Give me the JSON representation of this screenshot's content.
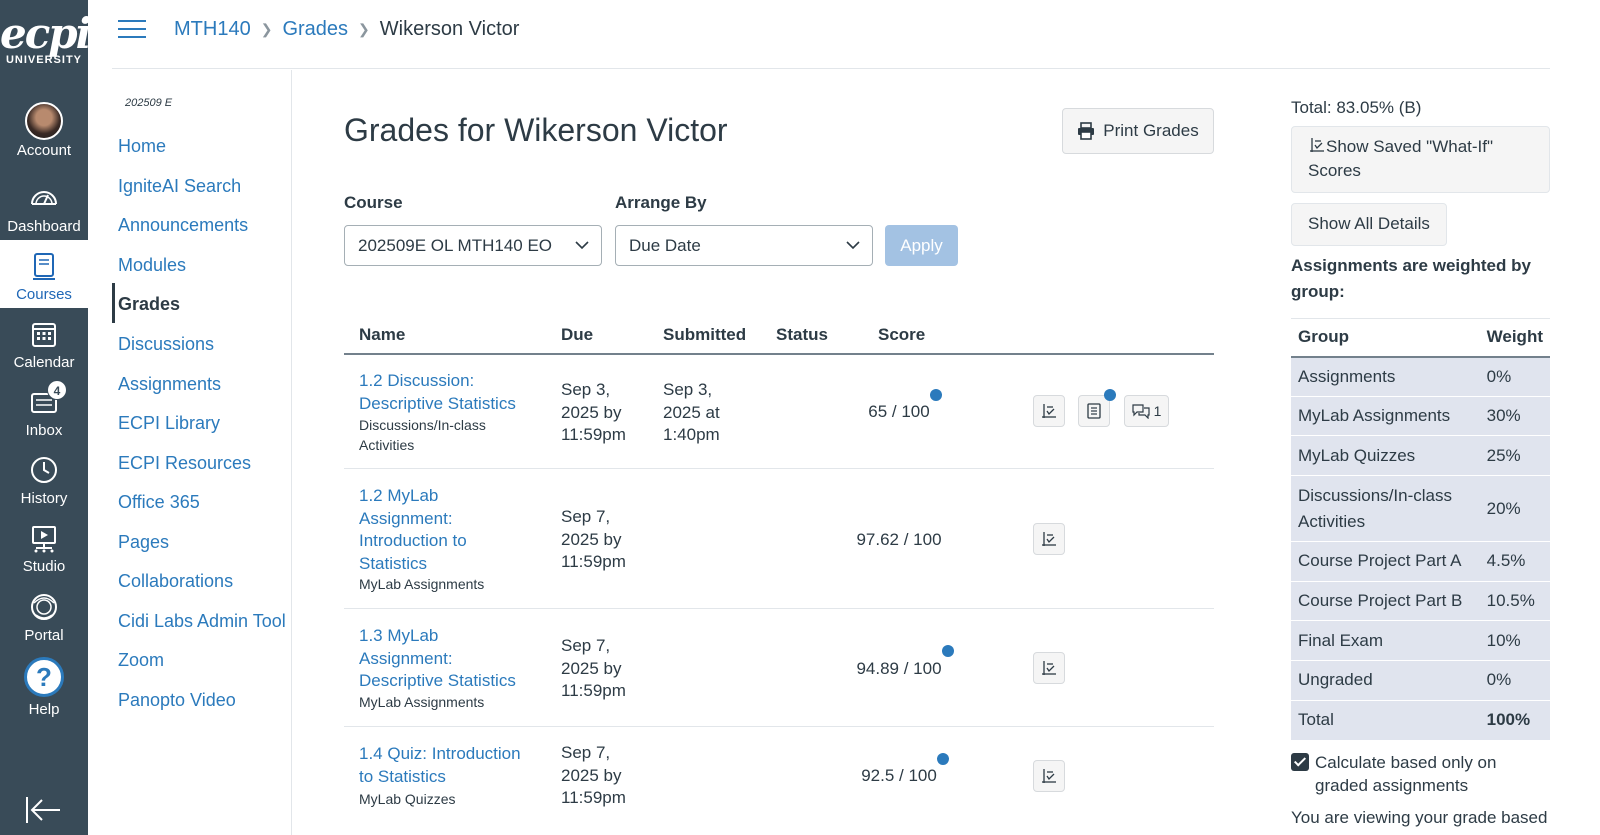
{
  "global_nav": {
    "logo_word": "ecpi",
    "logo_sub": "UNIVERSITY",
    "items": [
      {
        "label": "Account",
        "icon": "avatar"
      },
      {
        "label": "Dashboard",
        "icon": "dashboard-icon"
      },
      {
        "label": "Courses",
        "icon": "courses-icon"
      },
      {
        "label": "Calendar",
        "icon": "calendar-icon"
      },
      {
        "label": "Inbox",
        "icon": "inbox-icon",
        "badge": "4"
      },
      {
        "label": "History",
        "icon": "history-icon"
      },
      {
        "label": "Studio",
        "icon": "studio-icon"
      },
      {
        "label": "Portal",
        "icon": "portal-icon"
      },
      {
        "label": "Help",
        "icon": "help-icon"
      }
    ],
    "help_glyph": "?"
  },
  "breadcrumb": {
    "course": "MTH140",
    "section": "Grades",
    "current": "Wikerson Victor"
  },
  "course_nav": {
    "term": "202509 E",
    "items": [
      "Home",
      "IgniteAI Search",
      "Announcements",
      "Modules",
      "Grades",
      "Discussions",
      "Assignments",
      "ECPI Library",
      "ECPI Resources",
      "Office 365",
      "Pages",
      "Collaborations",
      "Cidi Labs Admin Tool",
      "Zoom",
      "Panopto Video"
    ],
    "active": "Grades"
  },
  "main": {
    "title": "Grades for Wikerson Victor",
    "print_label": "Print Grades",
    "course_label": "Course",
    "course_value": "202509E OL MTH140 EO",
    "arrange_label": "Arrange By",
    "arrange_value": "Due Date",
    "apply_label": "Apply",
    "columns": [
      "Name",
      "Due",
      "Submitted",
      "Status",
      "Score"
    ],
    "rows": [
      {
        "name_lines": [
          "1.2 Discussion:",
          "Descriptive Statistics"
        ],
        "group_lines": [
          "Discussions/In-class",
          "Activities"
        ],
        "due_lines": [
          "Sep 3,",
          "2025 by",
          "11:59pm"
        ],
        "submitted_lines": [
          "Sep 3,",
          "2025 at",
          "1:40pm"
        ],
        "status": "",
        "score": "65 / 100",
        "comment_count": "1"
      },
      {
        "name_lines": [
          "1.2 MyLab",
          "Assignment:",
          "Introduction to",
          "Statistics"
        ],
        "group_lines": [
          "MyLab Assignments"
        ],
        "due_lines": [
          "Sep 7,",
          "2025 by",
          "11:59pm"
        ],
        "submitted_lines": [],
        "status": "",
        "score": "97.62 / 100"
      },
      {
        "name_lines": [
          "1.3 MyLab",
          "Assignment:",
          "Descriptive Statistics"
        ],
        "group_lines": [
          "MyLab Assignments"
        ],
        "due_lines": [
          "Sep 7,",
          "2025 by",
          "11:59pm"
        ],
        "submitted_lines": [],
        "status": "",
        "score": "94.89 / 100"
      },
      {
        "name_lines": [
          "1.4 Quiz: Introduction",
          "to Statistics"
        ],
        "group_lines": [
          "MyLab Quizzes"
        ],
        "due_lines": [
          "Sep 7,",
          "2025 by",
          "11:59pm"
        ],
        "submitted_lines": [],
        "status": "",
        "score": "92.5 / 100"
      }
    ]
  },
  "sidebar": {
    "total": "Total: 83.05% (B)",
    "what_if_line1": "Show Saved \"What-If\"",
    "what_if_line2": "Scores",
    "show_details": "Show All Details",
    "weighted_note": "Assignments are weighted by group:",
    "weight_headers": [
      "Group",
      "Weight"
    ],
    "weights": [
      {
        "group": "Assignments",
        "weight": "0%"
      },
      {
        "group": "MyLab Assignments",
        "weight": "30%"
      },
      {
        "group": "MyLab Quizzes",
        "weight": "25%"
      },
      {
        "group": "Discussions/In-class Activities",
        "weight": "20%"
      },
      {
        "group": "Course Project Part A",
        "weight": "4.5%"
      },
      {
        "group": "Course Project Part B",
        "weight": "10.5%"
      },
      {
        "group": "Final Exam",
        "weight": "10%"
      },
      {
        "group": "Ungraded",
        "weight": "0%"
      },
      {
        "group": "Total",
        "weight": "100%"
      }
    ],
    "calc_label": "Calculate based only on graded assignments",
    "calc_checked": true,
    "cutoff_text": "You are viewing your grade based"
  },
  "colors": {
    "nav_bg": "#394b58",
    "link": "#2b7abc",
    "text": "#2d3b45",
    "unread_dot": "#2b7abc",
    "weight_row_bg": "#e0e4ee"
  }
}
